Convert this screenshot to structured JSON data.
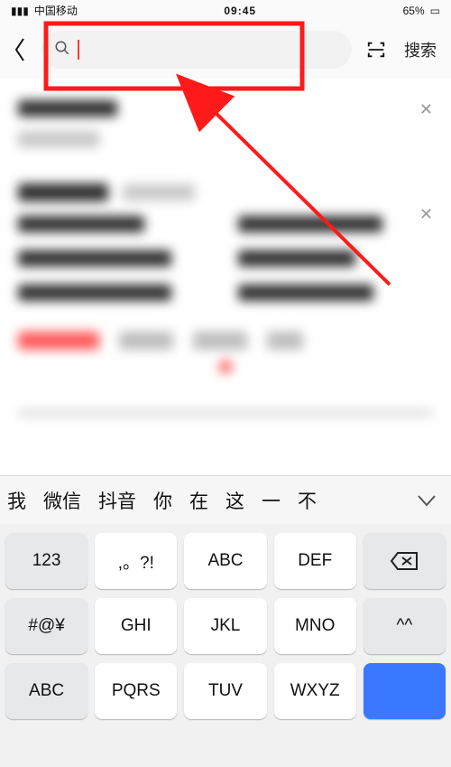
{
  "statusbar": {
    "carrier": "中国移动",
    "time": "09:45",
    "battery": "65%"
  },
  "topbar": {
    "search_label": "搜索"
  },
  "keyboard": {
    "suggestions": [
      "我",
      "微信",
      "抖音",
      "你",
      "在",
      "这",
      "一",
      "不"
    ],
    "rows": [
      [
        {
          "label": "123",
          "name": "key-123",
          "type": "gray"
        },
        {
          "label": ",。?!",
          "name": "key-punct",
          "type": "white"
        },
        {
          "label": "ABC",
          "name": "key-abc2",
          "type": "white"
        },
        {
          "label": "DEF",
          "name": "key-def",
          "type": "white"
        },
        {
          "label": "",
          "name": "key-backspace",
          "type": "gray",
          "icon": "bksp"
        }
      ],
      [
        {
          "label": "#@¥",
          "name": "key-symbols",
          "type": "gray"
        },
        {
          "label": "GHI",
          "name": "key-ghi",
          "type": "white"
        },
        {
          "label": "JKL",
          "name": "key-jkl",
          "type": "white"
        },
        {
          "label": "MNO",
          "name": "key-mno",
          "type": "white"
        },
        {
          "label": "^^",
          "name": "key-emoticon",
          "type": "gray"
        }
      ],
      [
        {
          "label": "ABC",
          "name": "key-mode-abc",
          "type": "gray"
        },
        {
          "label": "PQRS",
          "name": "key-pqrs",
          "type": "white"
        },
        {
          "label": "TUV",
          "name": "key-tuv",
          "type": "white"
        },
        {
          "label": "WXYZ",
          "name": "key-wxyz",
          "type": "white"
        },
        {
          "label": "",
          "name": "key-confirm",
          "type": "blue"
        }
      ]
    ]
  }
}
